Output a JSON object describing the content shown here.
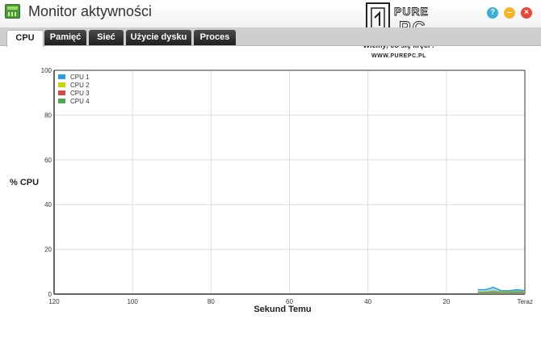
{
  "window": {
    "title": "Monitor aktywności",
    "watermark": {
      "brand_top": "PURE",
      "brand_bottom": "PC",
      "tagline": "Wiemy, co się kręci !",
      "url": "WWW.PUREPC.PL"
    }
  },
  "tabs": [
    {
      "label": "CPU",
      "active": true
    },
    {
      "label": "Pamięć",
      "active": false
    },
    {
      "label": "Sieć",
      "active": false
    },
    {
      "label": "Użycie dysku",
      "active": false
    },
    {
      "label": "Proces",
      "active": false
    }
  ],
  "chart_data": {
    "type": "line",
    "ylabel": "% CPU",
    "xlabel": "Sekund Temu",
    "ylim": [
      0,
      100
    ],
    "xlim": [
      120,
      0
    ],
    "y_ticks": [
      "0",
      "20",
      "40",
      "60",
      "80",
      "100"
    ],
    "x_ticks": [
      "120",
      "100",
      "80",
      "60",
      "40",
      "20",
      "Teraz"
    ],
    "x_tick_values": [
      120,
      100,
      80,
      60,
      40,
      20,
      0
    ],
    "grid": true,
    "legend_position": "top-left",
    "x": [
      12,
      10,
      8,
      6,
      4,
      2,
      0
    ],
    "series": [
      {
        "name": "CPU 1",
        "color": "#2b9fe0",
        "values": [
          2,
          2,
          3,
          1.5,
          1.5,
          2,
          1.5
        ]
      },
      {
        "name": "CPU 2",
        "color": "#c6d400",
        "values": [
          1,
          1,
          1.5,
          1,
          1,
          1.5,
          1
        ]
      },
      {
        "name": "CPU 3",
        "color": "#d14b4b",
        "values": [
          0.5,
          0.5,
          0.8,
          0.5,
          0.6,
          0.6,
          0.5
        ]
      },
      {
        "name": "CPU 4",
        "color": "#4da84d",
        "values": [
          0.8,
          0.8,
          1,
          0.7,
          0.8,
          1,
          0.8
        ]
      }
    ]
  }
}
